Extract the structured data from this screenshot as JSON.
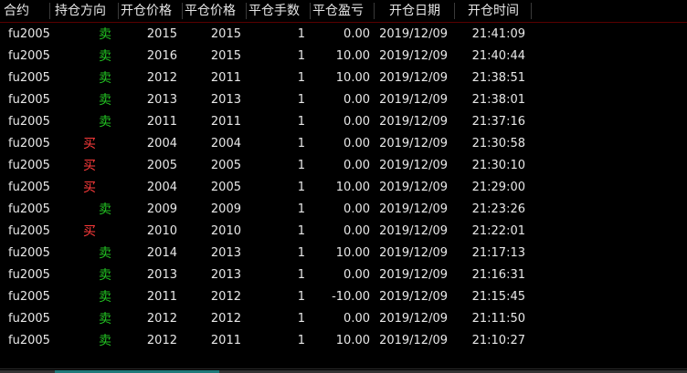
{
  "table": {
    "headers": [
      "合约",
      "持仓方向",
      "开仓价格",
      "平仓价格",
      "平仓手数",
      "平仓盈亏",
      "开仓日期",
      "开仓时间"
    ],
    "rows": [
      {
        "contract": "fu2005",
        "direction": "卖",
        "dir_type": "sell",
        "open_price": "2015",
        "close_price": "2015",
        "lots": "1",
        "pnl": "0.00",
        "date": "2019/12/09",
        "time": "21:41:09"
      },
      {
        "contract": "fu2005",
        "direction": "卖",
        "dir_type": "sell",
        "open_price": "2016",
        "close_price": "2015",
        "lots": "1",
        "pnl": "10.00",
        "date": "2019/12/09",
        "time": "21:40:44"
      },
      {
        "contract": "fu2005",
        "direction": "卖",
        "dir_type": "sell",
        "open_price": "2012",
        "close_price": "2011",
        "lots": "1",
        "pnl": "10.00",
        "date": "2019/12/09",
        "time": "21:38:51"
      },
      {
        "contract": "fu2005",
        "direction": "卖",
        "dir_type": "sell",
        "open_price": "2013",
        "close_price": "2013",
        "lots": "1",
        "pnl": "0.00",
        "date": "2019/12/09",
        "time": "21:38:01"
      },
      {
        "contract": "fu2005",
        "direction": "卖",
        "dir_type": "sell",
        "open_price": "2011",
        "close_price": "2011",
        "lots": "1",
        "pnl": "0.00",
        "date": "2019/12/09",
        "time": "21:37:16"
      },
      {
        "contract": "fu2005",
        "direction": "买",
        "dir_type": "buy",
        "open_price": "2004",
        "close_price": "2004",
        "lots": "1",
        "pnl": "0.00",
        "date": "2019/12/09",
        "time": "21:30:58"
      },
      {
        "contract": "fu2005",
        "direction": "买",
        "dir_type": "buy",
        "open_price": "2005",
        "close_price": "2005",
        "lots": "1",
        "pnl": "0.00",
        "date": "2019/12/09",
        "time": "21:30:10"
      },
      {
        "contract": "fu2005",
        "direction": "买",
        "dir_type": "buy",
        "open_price": "2004",
        "close_price": "2005",
        "lots": "1",
        "pnl": "10.00",
        "date": "2019/12/09",
        "time": "21:29:00"
      },
      {
        "contract": "fu2005",
        "direction": "卖",
        "dir_type": "sell",
        "open_price": "2009",
        "close_price": "2009",
        "lots": "1",
        "pnl": "0.00",
        "date": "2019/12/09",
        "time": "21:23:26"
      },
      {
        "contract": "fu2005",
        "direction": "买",
        "dir_type": "buy",
        "open_price": "2010",
        "close_price": "2010",
        "lots": "1",
        "pnl": "0.00",
        "date": "2019/12/09",
        "time": "21:22:01"
      },
      {
        "contract": "fu2005",
        "direction": "卖",
        "dir_type": "sell",
        "open_price": "2014",
        "close_price": "2013",
        "lots": "1",
        "pnl": "10.00",
        "date": "2019/12/09",
        "time": "21:17:13"
      },
      {
        "contract": "fu2005",
        "direction": "卖",
        "dir_type": "sell",
        "open_price": "2013",
        "close_price": "2013",
        "lots": "1",
        "pnl": "0.00",
        "date": "2019/12/09",
        "time": "21:16:31"
      },
      {
        "contract": "fu2005",
        "direction": "卖",
        "dir_type": "sell",
        "open_price": "2011",
        "close_price": "2012",
        "lots": "1",
        "pnl": "-10.00",
        "date": "2019/12/09",
        "time": "21:15:45"
      },
      {
        "contract": "fu2005",
        "direction": "卖",
        "dir_type": "sell",
        "open_price": "2012",
        "close_price": "2012",
        "lots": "1",
        "pnl": "0.00",
        "date": "2019/12/09",
        "time": "21:11:50"
      },
      {
        "contract": "fu2005",
        "direction": "卖",
        "dir_type": "sell",
        "open_price": "2012",
        "close_price": "2011",
        "lots": "1",
        "pnl": "10.00",
        "date": "2019/12/09",
        "time": "21:10:27"
      }
    ]
  },
  "colors": {
    "background": "#000000",
    "sell": "#22c322",
    "buy": "#ff3b3b",
    "text": "#e8e8e8",
    "header_border": "#5a0000"
  }
}
